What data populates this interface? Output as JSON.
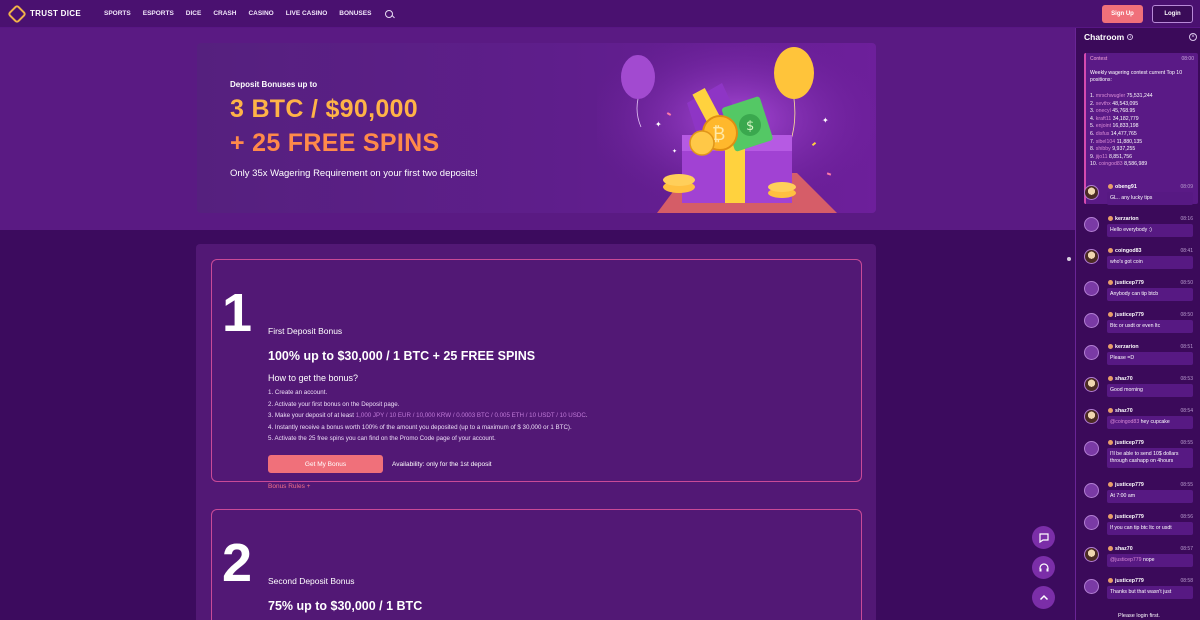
{
  "header": {
    "logo_text": "TRUST DICE",
    "nav": [
      "SPORTS",
      "ESPORTS",
      "DICE",
      "CRASH",
      "CASINO",
      "LIVE CASINO",
      "BONUSES"
    ],
    "signup_label": "Sign Up",
    "login_label": "Login"
  },
  "hero": {
    "pre": "Deposit Bonuses up to",
    "line1": "3 BTC / $90,000",
    "line2": "+ 25 FREE SPINS",
    "sub": "Only 35x Wagering Requirement on your first two deposits!"
  },
  "bonus1": {
    "number": "1",
    "title": "First Deposit Bonus",
    "headline": "100% up to $30,000 / 1 BTC + 25 FREE SPINS",
    "howto": "How to get the bonus?",
    "step1": "1. Create an account.",
    "step2": "2. Activate your first bonus on the Deposit page.",
    "step3_prefix": "3. Make your deposit of at least ",
    "step3_amounts": "1,000 JPY / 10 EUR / 10,000 KRW / 0.0003 BTC / 0.005 ETH / 10 USDT / 10 USDC",
    "step3_suffix": ".",
    "step4": "4. Instantly receive a bonus worth 100% of the amount you deposited (up to a maximum of $ 30,000 or 1 BTC).",
    "step5": "5. Activate the 25 free spins you can find on the Promo Code page of your account.",
    "button": "Get My Bonus",
    "availability": "Availability: only for the 1st deposit",
    "rules": "Bonus Rules +"
  },
  "bonus2": {
    "number": "2",
    "title": "Second Deposit Bonus",
    "headline": "75% up to $30,000 / 1 BTC"
  },
  "chat": {
    "title": "Chatroom",
    "contest": {
      "tag": "Contest",
      "time": "08:00",
      "text": "Weekly wagering contest current Top 10 positions:",
      "entries": [
        {
          "rank": "1.",
          "name": "mrschwugler",
          "amount": "75,531,244"
        },
        {
          "rank": "2.",
          "name": "xevthx",
          "amount": "48,543,095"
        },
        {
          "rank": "3.",
          "name": "onecyl",
          "amount": "45,768.95"
        },
        {
          "rank": "4.",
          "name": "kraft11",
          "amount": "34,182,779"
        },
        {
          "rank": "5.",
          "name": "enjoint",
          "amount": "16,833,198"
        },
        {
          "rank": "6.",
          "name": "disfus",
          "amount": "14,477,765"
        },
        {
          "rank": "7.",
          "name": "sibel104",
          "amount": "11,880,135"
        },
        {
          "rank": "8.",
          "name": "shibby",
          "amount": "9,937,255"
        },
        {
          "rank": "9.",
          "name": "jijo11",
          "amount": "8,851,756"
        },
        {
          "rank": "10.",
          "name": "coingod83",
          "amount": "8,586,989"
        }
      ]
    },
    "messages": [
      {
        "user": "obeng91",
        "time": "08:09",
        "text": "GL.. any lucky tips"
      },
      {
        "user": "kerzarion",
        "time": "08:16",
        "text": "Hello everybody :)"
      },
      {
        "user": "coingod83",
        "time": "08:41",
        "text": "who's got coin"
      },
      {
        "user": "justicep779",
        "time": "08:50",
        "text": "Anybody can tip btcb"
      },
      {
        "user": "justicep779",
        "time": "08:50",
        "text": "Btc or usdt or even ltc"
      },
      {
        "user": "kerzarion",
        "time": "08:51",
        "text": "Please =D"
      },
      {
        "user": "shaz70",
        "time": "08:53",
        "text": "Good morning"
      },
      {
        "user": "shaz70",
        "time": "08:54",
        "mention": "@coingod83",
        "text": " hey cupcake"
      },
      {
        "user": "justicep779",
        "time": "08:55",
        "text": "I'll be able to send 10$ dollars through cashapp on 4hours"
      },
      {
        "user": "justicep779",
        "time": "08:55",
        "text": "At 7:00 am"
      },
      {
        "user": "justicep779",
        "time": "08:56",
        "text": "If you can tip btc ltc or usdt"
      },
      {
        "user": "shaz70",
        "time": "08:57",
        "mention": "@justicep779",
        "text": " nope"
      },
      {
        "user": "justicep779",
        "time": "08:58",
        "text": "Thanks but that wasn't just"
      }
    ],
    "footer": "Please login first."
  },
  "colors": {
    "accent": "#f0707a",
    "hero_gold": "#ffb347",
    "hero_orange": "#ff8a4a",
    "panel_border": "#c94a97"
  }
}
